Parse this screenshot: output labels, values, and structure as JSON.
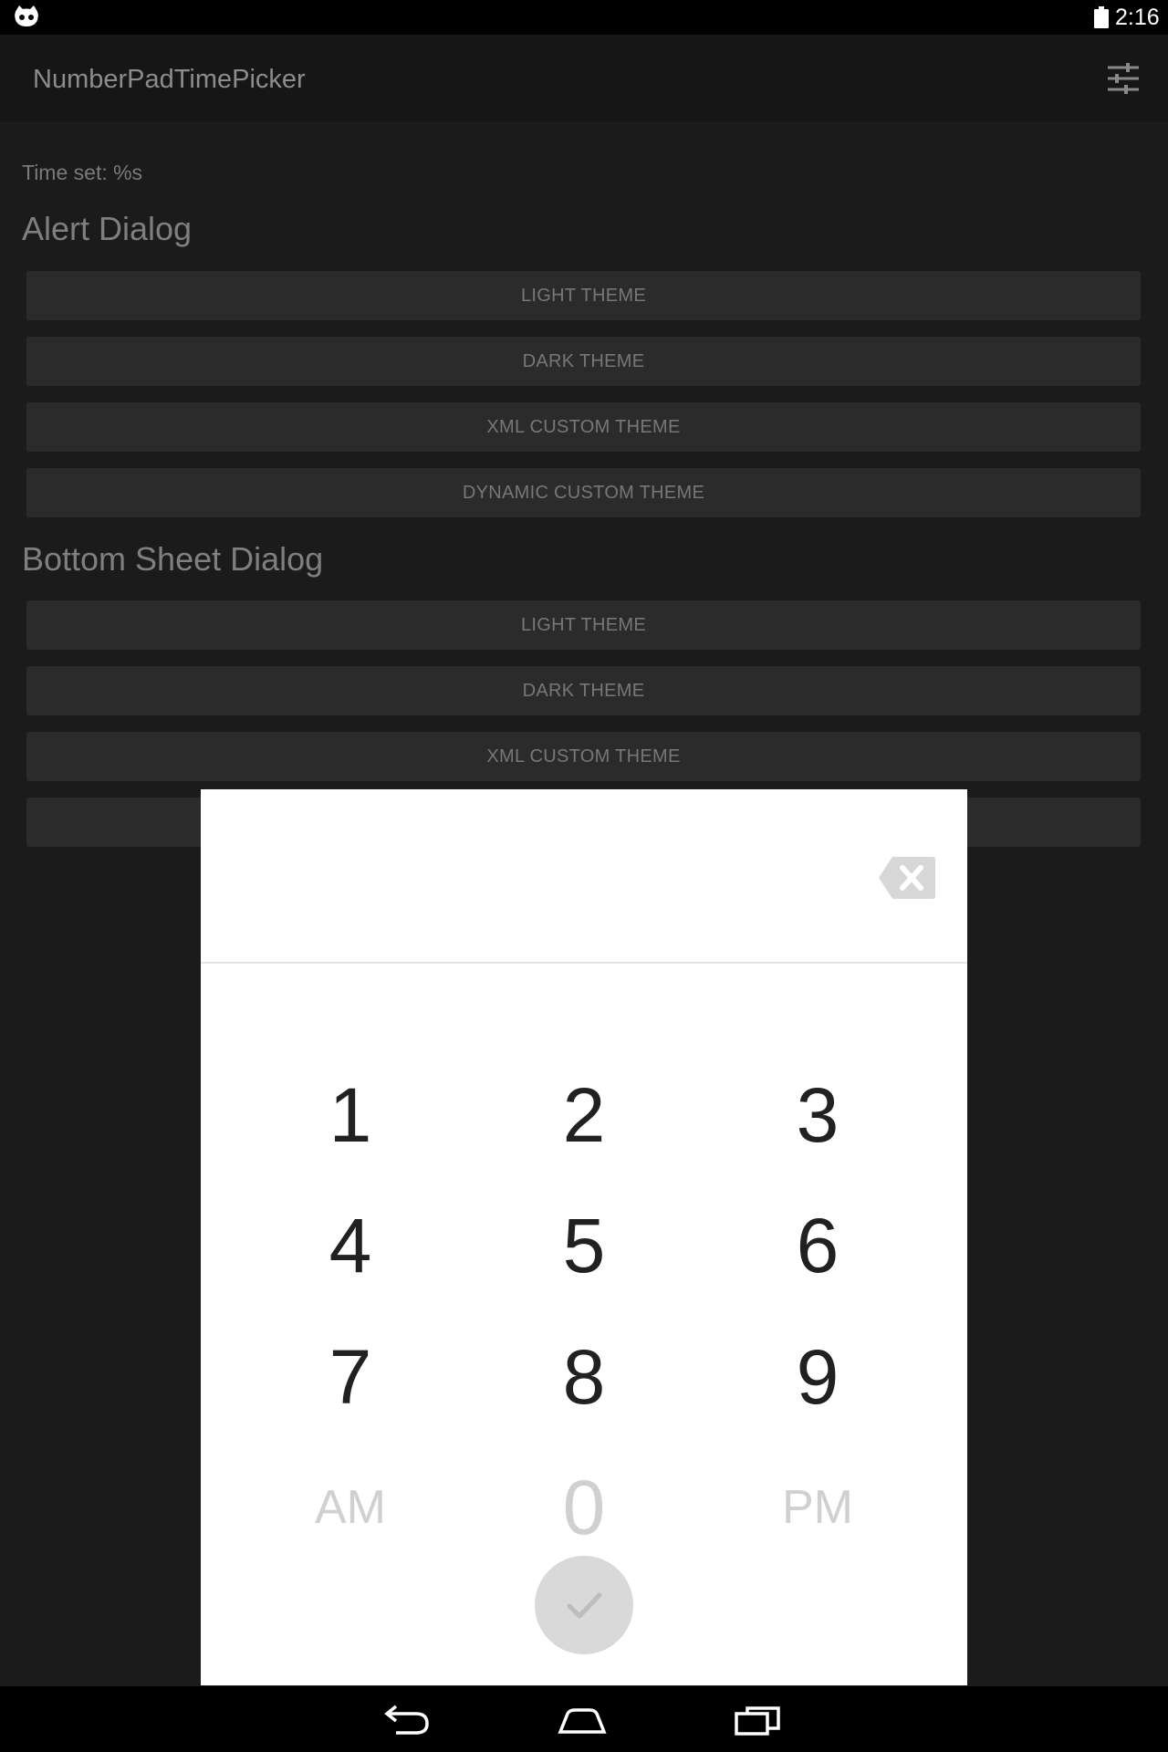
{
  "status_bar": {
    "time": "2:16",
    "left_icon": "cyanogenmod-icon",
    "battery_icon": "battery-icon"
  },
  "app_bar": {
    "title": "NumberPadTimePicker",
    "action_icon": "tune-icon"
  },
  "content": {
    "time_set": "Time set: %s",
    "sections": [
      {
        "title": "Alert Dialog",
        "buttons": [
          "LIGHT THEME",
          "DARK THEME",
          "XML CUSTOM THEME",
          "DYNAMIC CUSTOM THEME"
        ]
      },
      {
        "title": "Bottom Sheet Dialog",
        "buttons": [
          "LIGHT THEME",
          "DARK THEME",
          "XML CUSTOM THEME"
        ]
      }
    ]
  },
  "dialog": {
    "backspace_icon": "backspace-icon",
    "keys": [
      "1",
      "2",
      "3",
      "4",
      "5",
      "6",
      "7",
      "8",
      "9",
      "AM",
      "0",
      "PM"
    ],
    "confirm_icon": "check-icon"
  },
  "nav_bar": {
    "icons": [
      "back-icon",
      "home-icon",
      "recents-icon"
    ]
  },
  "colors": {
    "background": "#1b1b1b",
    "app_bar": "#161616",
    "button": "#2b2b2b",
    "dialog": "#ffffff",
    "key_text": "#212121",
    "disabled_text": "#d0d0d0"
  }
}
